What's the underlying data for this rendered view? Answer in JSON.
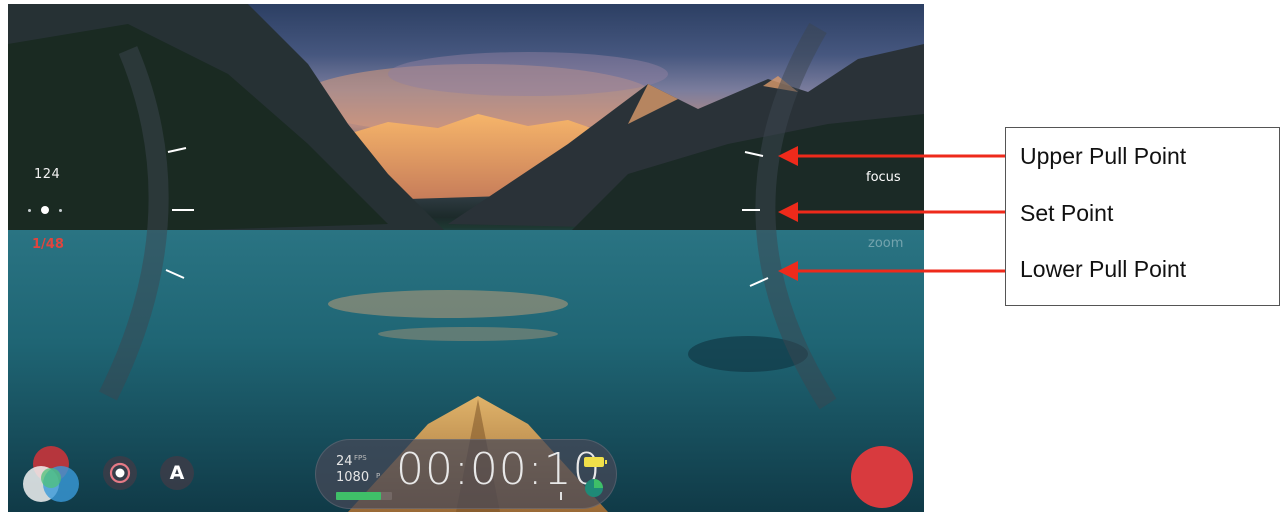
{
  "viewfinder": {
    "exposure": {
      "shutter_value": "124",
      "iso_value": "1/48",
      "iso_color": "#e0453e"
    },
    "focus_dial": {
      "focus_label": "focus",
      "zoom_label": "zoom"
    },
    "toolbar": {
      "color_icon": "color-wheel-icon",
      "stabilize_icon": "stabilize-icon",
      "auto_label": "A"
    },
    "recording_info": {
      "fps": "24",
      "fps_unit": "FPS",
      "resolution": "1080",
      "resolution_unit": "P",
      "timecode": "00:00:10",
      "storage_fraction": 0.8,
      "storage_color": "#3fbf68",
      "battery_color": "#f1e04a"
    },
    "record_button": {
      "color": "#d83a3e"
    }
  },
  "callouts": {
    "upper_pull_point": "Upper Pull Point",
    "set_point": "Set Point",
    "lower_pull_point": "Lower Pull Point",
    "arrow_color": "#ee2a1b"
  }
}
